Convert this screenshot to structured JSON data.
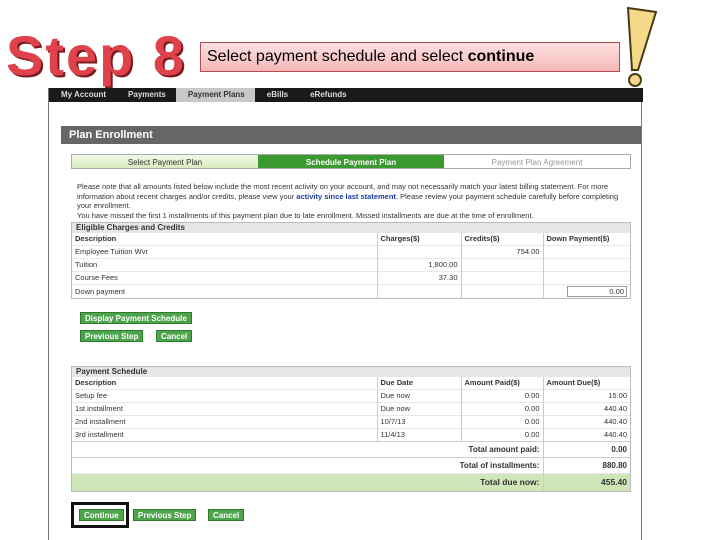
{
  "header": {
    "step_label": "Step 8",
    "instruction_prefix": "Select payment schedule and select ",
    "instruction_bold": "continue"
  },
  "nav": {
    "tabs": [
      {
        "label": "My Account",
        "active": false
      },
      {
        "label": "Payments",
        "active": false
      },
      {
        "label": "Payment Plans",
        "active": true
      },
      {
        "label": "eBills",
        "active": false
      },
      {
        "label": "eRefunds",
        "active": false
      }
    ]
  },
  "panel_title": "Plan Enrollment",
  "wizard_steps": [
    {
      "label": "Select Payment Plan",
      "state": "done"
    },
    {
      "label": "Schedule Payment Plan",
      "state": "active"
    },
    {
      "label": "Payment Plan Agreement",
      "state": "future"
    }
  ],
  "notice": {
    "part1": "Please note that all amounts listed below include the most recent activity on your account, and may not necessarily match your latest billing statement. For more information about recent charges and/or credits, please view your ",
    "link": "activity since last statement",
    "part2": ". Please review your payment schedule carefully before completing your enrollment.",
    "line2": "You have missed the first 1 installments of this payment plan due to late enrollment. Missed installments are due at the time of enrollment."
  },
  "eligible": {
    "title": "Eligible Charges and Credits",
    "columns": [
      "Description",
      "Charges($)",
      "Credits($)",
      "Down Payment($)"
    ],
    "rows": [
      {
        "desc": "Employee Tuition Wvr",
        "charges": "",
        "credits": "754.00"
      },
      {
        "desc": "Tuition",
        "charges": "1,800.00",
        "credits": ""
      },
      {
        "desc": "Course Fees",
        "charges": "37.30",
        "credits": ""
      }
    ],
    "down_payment_label": "Down payment",
    "down_payment_value": "0.00"
  },
  "buttons": {
    "display_schedule": "Display Payment Schedule",
    "previous": "Previous Step",
    "cancel": "Cancel",
    "continue": "Continue"
  },
  "schedule": {
    "title": "Payment Schedule",
    "columns": [
      "Description",
      "Due Date",
      "Amount Paid($)",
      "Amount Due($)"
    ],
    "rows": [
      {
        "desc": "Setup fee",
        "due": "Due now",
        "paid": "0.00",
        "amount": "15.00"
      },
      {
        "desc": "1st installment",
        "due": "Due now",
        "paid": "0.00",
        "amount": "440.40"
      },
      {
        "desc": "2nd installment",
        "due": "10/7/13",
        "paid": "0.00",
        "amount": "440.40"
      },
      {
        "desc": "3rd installment",
        "due": "11/4/13",
        "paid": "0.00",
        "amount": "440.40"
      }
    ],
    "total_paid_label": "Total amount paid:",
    "total_paid_value": "0.00",
    "total_installments_label": "Total of installments:",
    "total_installments_value": "880.80",
    "total_due_label": "Total due now:",
    "total_due_value": "455.40"
  },
  "colors": {
    "step_red": "#e0424b",
    "accent_green": "#4da44a",
    "active_step_green": "#3b9a2f",
    "link_blue": "#1a3fa0"
  }
}
